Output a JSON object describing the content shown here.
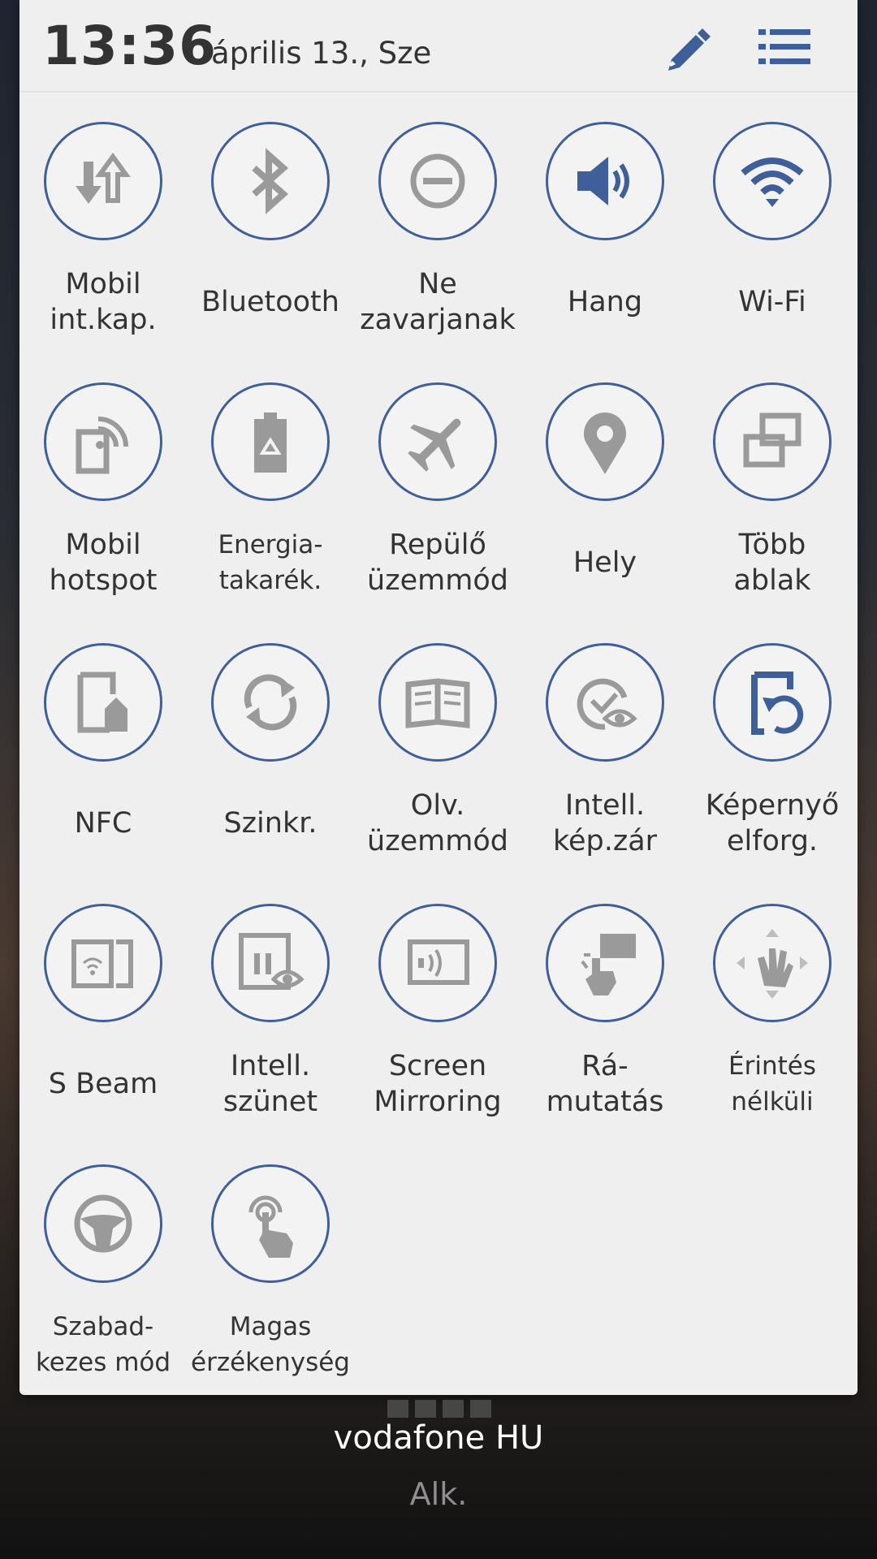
{
  "status": {
    "time": "13:36",
    "date": "április 13., Sze"
  },
  "header": {
    "edit_icon": "pencil-icon",
    "list_icon": "list-icon"
  },
  "colors": {
    "active": "#3f5f9a",
    "inactive": "#9a9a9a",
    "panel": "#efefef",
    "border": "#3f5f9a"
  },
  "toggles": [
    {
      "label": "Mobil\nint.kap.",
      "icon": "mobile-data-icon",
      "active": false
    },
    {
      "label": "Bluetooth",
      "icon": "bluetooth-icon",
      "active": false
    },
    {
      "label": "Ne\nzavarjanak",
      "icon": "do-not-disturb-icon",
      "active": false
    },
    {
      "label": "Hang",
      "icon": "sound-icon",
      "active": true
    },
    {
      "label": "Wi-Fi",
      "icon": "wifi-icon",
      "active": true
    },
    {
      "label": "Mobil\nhotspot",
      "icon": "hotspot-icon",
      "active": false
    },
    {
      "label": "Energia-\ntakarék.",
      "icon": "power-saving-icon",
      "active": false
    },
    {
      "label": "Repülő\nüzemmód",
      "icon": "airplane-icon",
      "active": false
    },
    {
      "label": "Hely",
      "icon": "location-icon",
      "active": false
    },
    {
      "label": "Több\nablak",
      "icon": "multi-window-icon",
      "active": false
    },
    {
      "label": "NFC",
      "icon": "nfc-icon",
      "active": false
    },
    {
      "label": "Szinkr.",
      "icon": "sync-icon",
      "active": false
    },
    {
      "label": "Olv.\nüzemmód",
      "icon": "reading-mode-icon",
      "active": false
    },
    {
      "label": "Intell.\nkép.zár",
      "icon": "smart-stay-icon",
      "active": false
    },
    {
      "label": "Képernyő\nelforg.",
      "icon": "screen-rotation-icon",
      "active": true
    },
    {
      "label": "S Beam",
      "icon": "s-beam-icon",
      "active": false
    },
    {
      "label": "Intell.\nszünet",
      "icon": "smart-pause-icon",
      "active": false
    },
    {
      "label": "Screen\nMirroring",
      "icon": "screen-mirroring-icon",
      "active": false
    },
    {
      "label": "Rá-\nmutatás",
      "icon": "air-view-icon",
      "active": false
    },
    {
      "label": "Érintés\nnélküli",
      "icon": "air-gesture-icon",
      "active": false
    },
    {
      "label": "Szabad-\nkezes mód",
      "icon": "driving-mode-icon",
      "active": false
    },
    {
      "label": "Magas\nérzékenység",
      "icon": "touch-sensitivity-icon",
      "active": false
    }
  ],
  "footer": {
    "carrier": "vodafone HU",
    "button": "Alk."
  }
}
